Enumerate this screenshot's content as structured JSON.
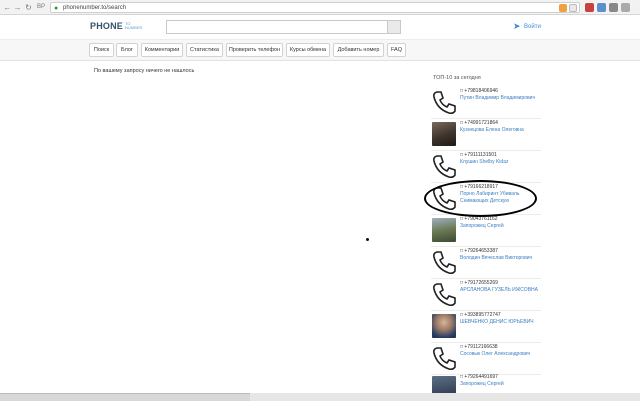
{
  "browser": {
    "url": "phonenumber.to/search",
    "back_icon": "arrow-left",
    "forward_icon": "arrow-right",
    "reload_icon": "reload",
    "home_label": "ВР"
  },
  "site": {
    "logo_main": "PHONE",
    "logo_sub": "TO NUMBER",
    "login_label": "Войти",
    "login_icon": "sign-in",
    "search_value": ""
  },
  "menu": {
    "items": [
      {
        "label": "Поиск"
      },
      {
        "label": "Блог"
      },
      {
        "label": "Комментарии"
      },
      {
        "label": "Статистика"
      },
      {
        "label": "Проверить телефон"
      },
      {
        "label": "Курсы обмена"
      },
      {
        "label": "Добавить номер"
      },
      {
        "label": "FAQ"
      }
    ]
  },
  "main": {
    "no_results": "По вашему запросу ничего не нашлось"
  },
  "sidebar": {
    "title": "ТОП-10 за сегодня",
    "entries": [
      {
        "phone": "+79818406946",
        "name": "Путин Владимир Владимирович",
        "thumb": "phone-icon"
      },
      {
        "phone": "+74991721864",
        "name": "Кузнецова Елена Олеговна",
        "thumb": "photo"
      },
      {
        "phone": "+79111131501",
        "name": "Клушин Shelby Kidaz",
        "thumb": "phone-icon"
      },
      {
        "phone": "+79166218917",
        "name": "Порно Лабиринт Убиваль Снимающих Детскую",
        "thumb": "phone-icon"
      },
      {
        "phone": "+79043761162",
        "name": "Запорожец Сергей",
        "thumb": "photo"
      },
      {
        "phone": "+79264653387",
        "name": "Володин Вячеслав Викторович",
        "thumb": "phone-icon"
      },
      {
        "phone": "+79172655269",
        "name": "АРСЛАНОВА ГУЗЕЛЬ ИЖСОВНА",
        "thumb": "phone-icon"
      },
      {
        "phone": "+393895772747",
        "name": "ШЕВЧЕНКО ДЕНИС ЮРЬЕВИЧ",
        "thumb": "photo"
      },
      {
        "phone": "+79112166638",
        "name": "Сосовык Олег Александрович",
        "thumb": "phone-icon"
      },
      {
        "phone": "+79264491697",
        "name": "Запорожец Сергей",
        "thumb": "photo"
      }
    ]
  },
  "colors": {
    "link": "#3a7fc4",
    "logo": "#33536d",
    "accent": "#3a8ed8"
  }
}
